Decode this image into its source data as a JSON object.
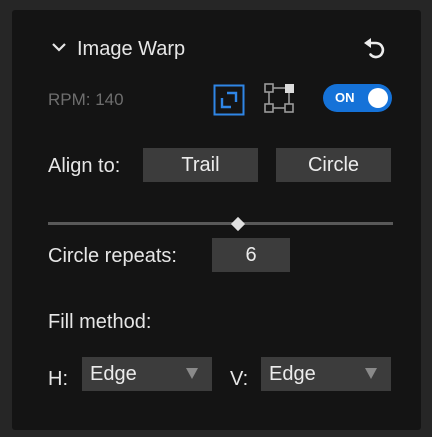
{
  "panel": {
    "title": "Image Warp",
    "collapse_icon": "chevron-down-icon",
    "reset_icon": "undo-icon"
  },
  "rpm": {
    "label": "RPM: 140"
  },
  "toolbar": {
    "fit_icon": "expand-frame-icon",
    "transform_icon": "transform-points-icon",
    "toggle_label": "ON",
    "toggle_on": true,
    "accent_color": "#1572d8"
  },
  "align": {
    "label": "Align to:",
    "options": [
      "Trail",
      "Circle"
    ]
  },
  "slider": {
    "value": 0.55
  },
  "repeats": {
    "label": "Circle repeats:",
    "value": "6"
  },
  "fill": {
    "label": "Fill method:",
    "h_label": "H:",
    "h_value": "Edge",
    "v_label": "V:",
    "v_value": "Edge"
  }
}
